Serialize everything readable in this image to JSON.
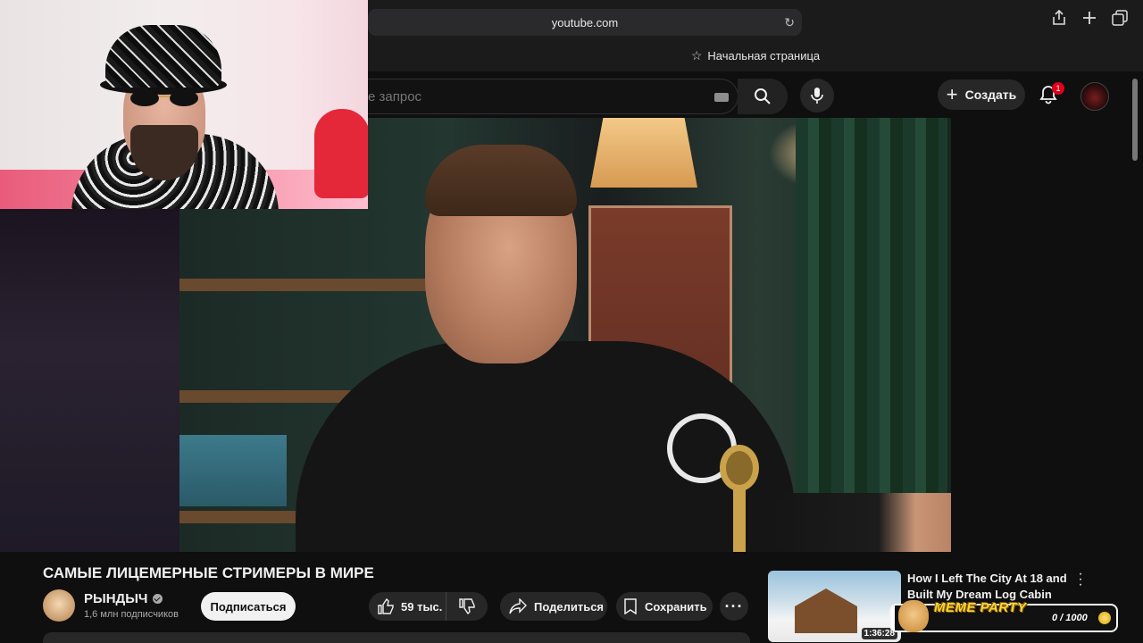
{
  "browser": {
    "url": "youtube.com",
    "bookmark_label": "Начальная страница"
  },
  "header": {
    "search_placeholder": "е запрос",
    "create_label": "Создать",
    "notification_count": "1"
  },
  "video": {
    "title": "САМЫЕ ЛИЦЕМЕРНЫЕ СТРИМЕРЫ В МИРЕ",
    "channel_name": "РЫНДЫЧ",
    "subscribers": "1,6 млн подписчиков",
    "subscribe_label": "Подписаться",
    "likes": "59 тыс.",
    "share_label": "Поделиться",
    "save_label": "Сохранить"
  },
  "recommendation": {
    "title": "How I Left The City At 18 and Built My Dream Log Cabin",
    "duration": "1:36:28"
  },
  "overlay": {
    "label": "MEME PARTY",
    "progress_text": "0 / 1000",
    "progress_value": 0,
    "progress_max": 1000
  },
  "colors": {
    "background": "#0f0f0f",
    "accent_badge": "#e0001b",
    "meme_label": "#ffd33a"
  },
  "icons": [
    "reload-icon",
    "share-icon",
    "new-tab-icon",
    "tabs-icon",
    "star-icon",
    "keyboard-icon",
    "search-icon",
    "mic-icon",
    "plus-icon",
    "bell-icon",
    "verified-icon",
    "like-icon",
    "dislike-icon",
    "share-arrow-icon",
    "bookmark-icon",
    "more-icon",
    "kebab-icon",
    "coin-icon"
  ]
}
